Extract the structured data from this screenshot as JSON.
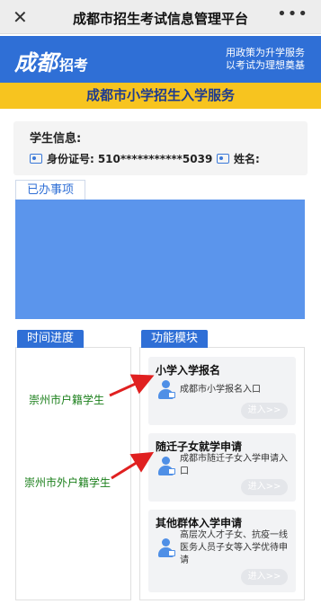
{
  "topbar": {
    "close_icon": "close-icon",
    "title": "成都市招生考试信息管理平台",
    "more_icon": "more-dots-icon"
  },
  "banner": {
    "logo_script": "成都",
    "logo_text": "招考",
    "slogan_line1": "用政策为升学服务",
    "slogan_line2": "以考试为理想奠基"
  },
  "service_title": "成都市小学招生入学服务",
  "student": {
    "label": "学生信息:",
    "id_label": "身份证号:",
    "id_value": "510***********5039",
    "name_label": "姓名:"
  },
  "tabs": {
    "done": "已办事项",
    "progress": "时间进度",
    "modules": "功能模块"
  },
  "progress_notes": [
    {
      "text": "崇州市户籍学生"
    },
    {
      "text": "崇州市外户籍学生"
    }
  ],
  "modules": [
    {
      "title": "小学入学报名",
      "desc": "成都市小学报名入口",
      "enter": "进入>>"
    },
    {
      "title": "随迁子女就学申请",
      "desc": "成都市随迁子女入学申请入口",
      "enter": "进入>>"
    },
    {
      "title": "其他群体入学申请",
      "desc": "高层次人才子女、抗疫一线医务人员子女等入学优待申请",
      "enter": "进入>>"
    }
  ],
  "colors": {
    "primary_blue": "#2f6fd6",
    "banner_yellow": "#f7c41f",
    "annotation_green": "#1a7f1a",
    "arrow_red": "#e02020"
  }
}
